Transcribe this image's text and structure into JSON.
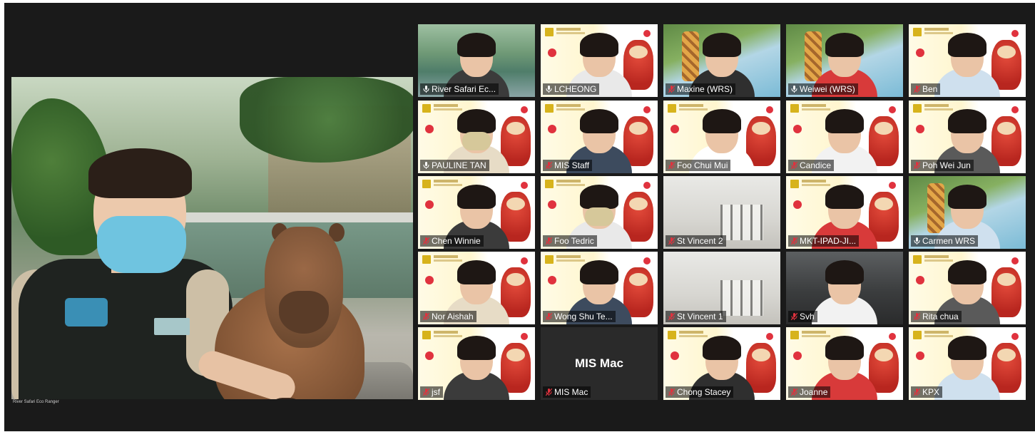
{
  "meeting": {
    "speaker_name": "River Safari Eco Ranger"
  },
  "gallery": [
    {
      "name": "River Safari Ec...",
      "bg": "pool",
      "highlight": true,
      "muted": false
    },
    {
      "name": "LCHEONG",
      "bg": "hl",
      "highlight": false,
      "muted": false
    },
    {
      "name": "Maxine (WRS)",
      "bg": "wild",
      "highlight": false,
      "muted": true
    },
    {
      "name": "Weiwei (WRS)",
      "bg": "wild",
      "highlight": false,
      "muted": false
    },
    {
      "name": "Ben",
      "bg": "hl",
      "highlight": false,
      "muted": true
    },
    {
      "name": "PAULINE TAN",
      "bg": "hl",
      "highlight": false,
      "muted": false
    },
    {
      "name": "MIS Staff",
      "bg": "hl",
      "highlight": false,
      "muted": true
    },
    {
      "name": "Foo Chui Mui",
      "bg": "hl",
      "highlight": false,
      "muted": true
    },
    {
      "name": "Candice",
      "bg": "hl",
      "highlight": false,
      "muted": true
    },
    {
      "name": "Poh Wei Jun",
      "bg": "hl",
      "highlight": false,
      "muted": true
    },
    {
      "name": "Chen Winnie",
      "bg": "hl",
      "highlight": false,
      "muted": true
    },
    {
      "name": "Foo Tedric",
      "bg": "hl",
      "highlight": false,
      "muted": true
    },
    {
      "name": "St Vincent 2",
      "bg": "room",
      "highlight": false,
      "muted": true
    },
    {
      "name": "MKT-IPAD-JI...",
      "bg": "hl",
      "highlight": false,
      "muted": true
    },
    {
      "name": "Carmen WRS",
      "bg": "wild",
      "highlight": false,
      "muted": false
    },
    {
      "name": "Nor Aishah",
      "bg": "hl",
      "highlight": false,
      "muted": true
    },
    {
      "name": "Wong Shu Te...",
      "bg": "hl",
      "highlight": false,
      "muted": true
    },
    {
      "name": "St Vincent 1",
      "bg": "room",
      "highlight": false,
      "muted": true
    },
    {
      "name": "Svh",
      "bg": "dark",
      "highlight": false,
      "muted": true
    },
    {
      "name": "Rita chua",
      "bg": "hl",
      "highlight": false,
      "muted": true
    },
    {
      "name": "jsf",
      "bg": "hl",
      "highlight": false,
      "muted": true
    },
    {
      "name": "MIS Mac",
      "bg": "plain",
      "highlight": false,
      "muted": true
    },
    {
      "name": "Chong Stacey",
      "bg": "hl",
      "highlight": false,
      "muted": true
    },
    {
      "name": "Joanne",
      "bg": "hl",
      "highlight": false,
      "muted": true
    },
    {
      "name": "KPX",
      "bg": "hl",
      "highlight": false,
      "muted": true
    }
  ],
  "colors": {
    "active_speaker_border": "#d4d84a",
    "muted_icon": "#e0323e",
    "meeting_bg": "#1a1a1a"
  },
  "icons": {
    "muted": "microphone-muted-icon",
    "unmuted": "microphone-icon"
  }
}
